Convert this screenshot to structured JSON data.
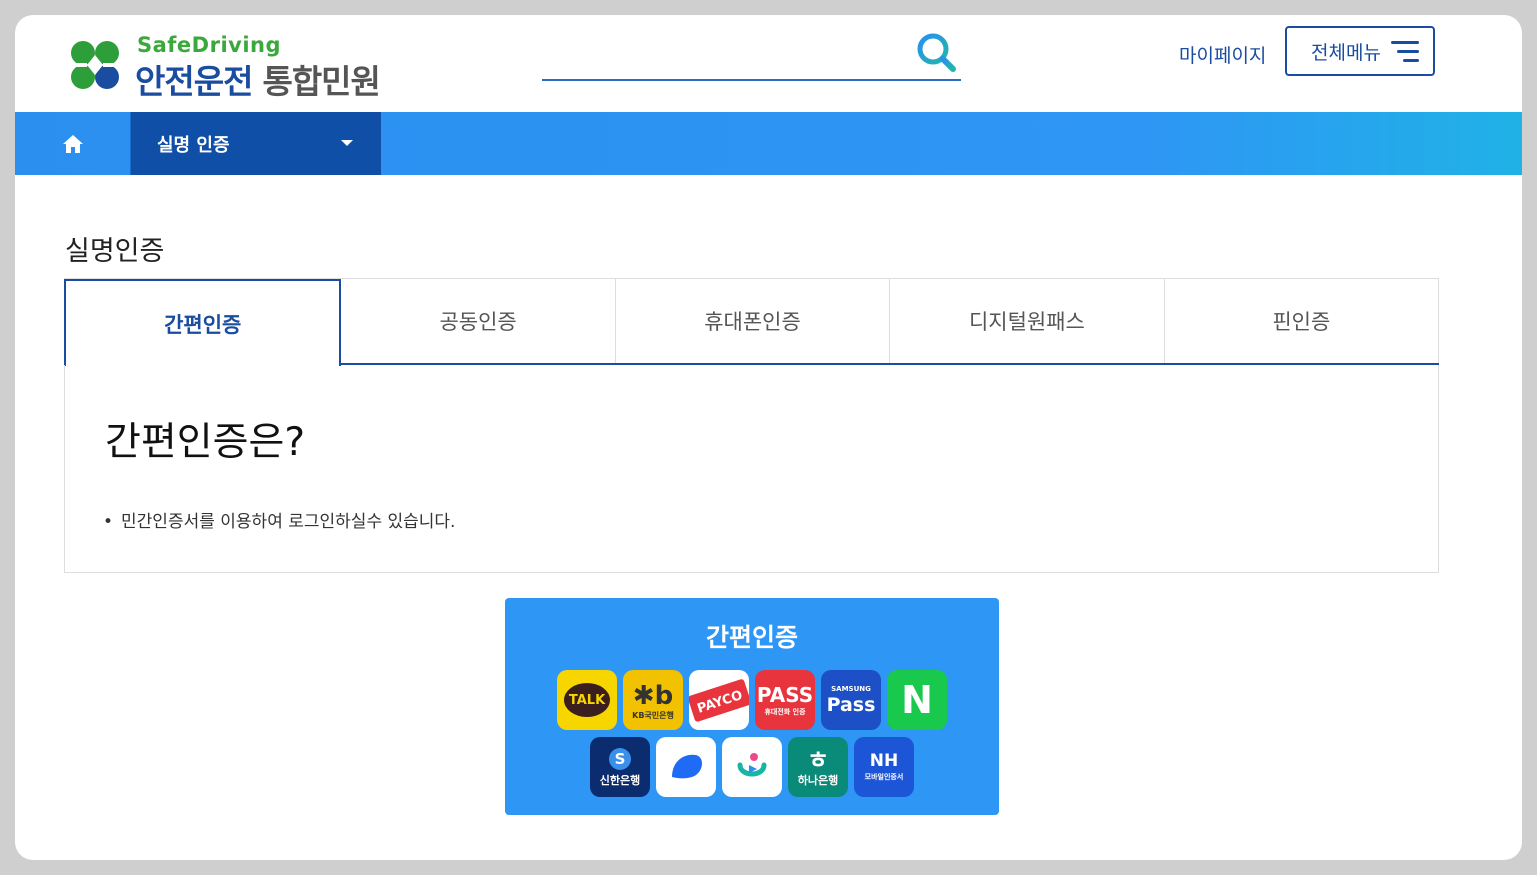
{
  "header": {
    "logo_sub": "SafeDriving",
    "logo_main": "안전운전",
    "logo_accent": "통합민원",
    "search_placeholder": "",
    "mypage_label": "마이페이지",
    "allmenu_label": "전체메뉴"
  },
  "nav": {
    "dropdown_label": "실명 인증"
  },
  "page": {
    "title": "실명인증",
    "tabs": [
      {
        "label": "간편인증",
        "active": true
      },
      {
        "label": "공동인증",
        "active": false
      },
      {
        "label": "휴대폰인증",
        "active": false
      },
      {
        "label": "디지털원패스",
        "active": false
      },
      {
        "label": "핀인증",
        "active": false
      }
    ],
    "info_heading": "간편인증은?",
    "info_bullet": "민간인증서를 이용하여 로그인하실수 있습니다."
  },
  "cert": {
    "title": "간편인증",
    "icons": [
      {
        "name": "kakao-talk-icon",
        "text": "TALK",
        "bg": "#f7d600"
      },
      {
        "name": "kb-icon",
        "text": "KB국민은행",
        "bg": "#f2c200"
      },
      {
        "name": "payco-icon",
        "text": "PAYCO",
        "bg": "#ffffff"
      },
      {
        "name": "pass-icon",
        "text": "PASS",
        "sub": "휴대전화 인증",
        "bg": "#e8343d"
      },
      {
        "name": "samsung-pass-icon",
        "text": "Pass",
        "sub": "SAMSUNG",
        "bg": "#1d4fc6"
      },
      {
        "name": "naver-icon",
        "text": "N",
        "bg": "#18c94d"
      },
      {
        "name": "shinhan-icon",
        "text": "신한은행",
        "bg": "#0b2c6e"
      },
      {
        "name": "toss-icon",
        "text": "",
        "bg": "#ffffff"
      },
      {
        "name": "smile-icon",
        "text": "",
        "bg": "#ffffff"
      },
      {
        "name": "hana-icon",
        "text": "하나은행",
        "bg": "#0a8a78"
      },
      {
        "name": "nh-icon",
        "text": "NH",
        "sub": "모바일인증서",
        "bg": "#1c55d6"
      }
    ]
  }
}
